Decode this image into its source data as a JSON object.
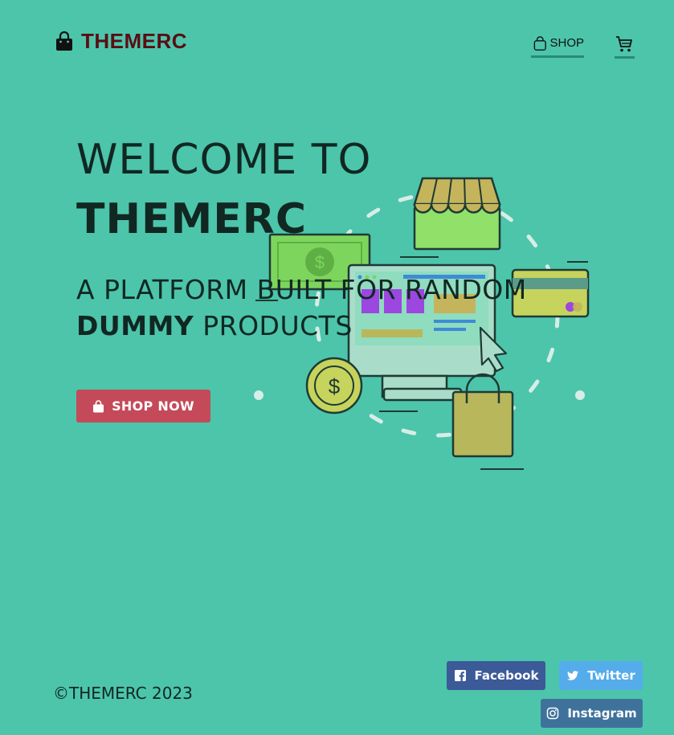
{
  "brand": {
    "name": "THEMERC"
  },
  "nav": {
    "shop_label": "SHOP"
  },
  "hero": {
    "title_line1": "WELCOME TO",
    "title_line2": "THEMERC",
    "subtitle_line1": "A PLATFORM BUILT FOR RANDOM",
    "subtitle_bold": "DUMMY",
    "subtitle_rest": " PRODUCTS",
    "cta_label": "SHOP NOW"
  },
  "footer": {
    "copyright": "©THEMERC 2023",
    "social": {
      "facebook": "Facebook",
      "twitter": "Twitter",
      "instagram": "Instagram"
    }
  },
  "colors": {
    "background": "#4cc5ab",
    "brand": "#5a0d12",
    "cta": "#c44a5a",
    "facebook": "#3b5a97",
    "twitter": "#55aceb",
    "instagram": "#3f729b"
  },
  "icons": {
    "brand": "shopping-bag-icon",
    "nav_shop": "shopping-bag-outline-icon",
    "nav_cart": "cart-icon",
    "cta": "shopping-bag-icon",
    "facebook": "facebook-icon",
    "twitter": "twitter-icon",
    "instagram": "instagram-icon"
  }
}
